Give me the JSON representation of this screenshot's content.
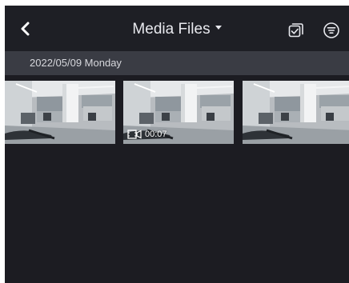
{
  "header": {
    "title": "Media Files",
    "back_icon": "chevron-left-icon",
    "title_dropdown_icon": "caret-down-icon",
    "select_icon": "checkbox-select-icon",
    "filter_icon": "filter-icon"
  },
  "date_group": {
    "label": "2022/05/09 Monday"
  },
  "media": [
    {
      "type": "photo"
    },
    {
      "type": "video",
      "duration": "00:07",
      "badge_icon": "video-film-icon"
    },
    {
      "type": "photo"
    }
  ],
  "colors": {
    "background": "#1c1c22",
    "header": "#1e1f25",
    "date_bar": "#3a3c44",
    "text": "#e8e9ee"
  }
}
